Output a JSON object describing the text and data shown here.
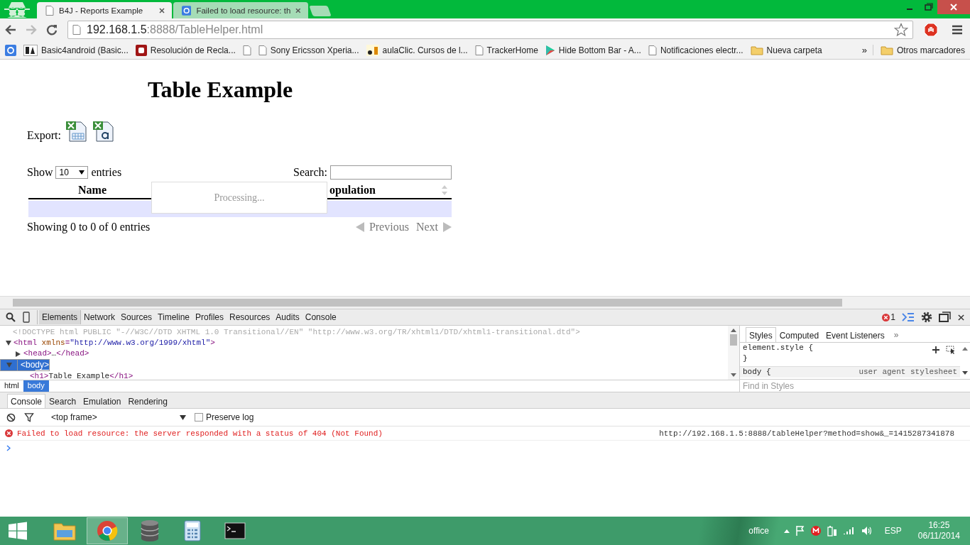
{
  "browser": {
    "tabs": [
      {
        "title": "B4J - Reports Example",
        "selected": true,
        "kind": "page"
      },
      {
        "title": "Failed to load resource: th",
        "selected": false,
        "kind": "g"
      }
    ],
    "address": {
      "host": "192.168.1.5",
      "rest": ":8888/TableHelper.html"
    },
    "bookmarks": [
      {
        "kind": "g"
      },
      {
        "kind": "b4a",
        "label": "Basic4android (Basic..."
      },
      {
        "kind": "e",
        "label": "Resolución de Recla..."
      },
      {
        "kind": "page"
      },
      {
        "kind": "page",
        "label": "Sony Ericsson Xperia..."
      },
      {
        "kind": "ac",
        "label": "aulaClic. Cursos de l..."
      },
      {
        "kind": "page",
        "label": "TrackerHome"
      },
      {
        "kind": "play",
        "label": "Hide Bottom Bar - A..."
      },
      {
        "kind": "page",
        "label": "Notificaciones electr..."
      },
      {
        "kind": "folder",
        "label": "Nueva carpeta"
      }
    ],
    "more": "»",
    "other": "Otros marcadores"
  },
  "page": {
    "heading": "Table Example",
    "export_label": "Export:",
    "exports": [
      {
        "kind": "sheet"
      },
      {
        "kind": "text"
      }
    ],
    "length": {
      "before": "Show",
      "value": "10",
      "after": "entries"
    },
    "search": {
      "label": "Search:"
    },
    "columns": [
      {
        "label": "Name"
      },
      {
        "label": "opulation"
      }
    ],
    "processing": "Processing...",
    "info": "Showing 0 to 0 of 0 entries",
    "pager": [
      {
        "kind": "previous",
        "label": "Previous",
        "disabled": true
      },
      {
        "kind": "next",
        "label": "Next",
        "disabled": true
      }
    ]
  },
  "devtools": {
    "panels": [
      {
        "label": "Elements",
        "selected": true
      },
      {
        "label": "Network",
        "selected": false
      },
      {
        "label": "Sources",
        "selected": false
      },
      {
        "label": "Timeline",
        "selected": false
      },
      {
        "label": "Profiles",
        "selected": false
      },
      {
        "label": "Resources",
        "selected": false
      },
      {
        "label": "Audits",
        "selected": false
      },
      {
        "label": "Console",
        "selected": false
      }
    ],
    "error_count": "1",
    "dom": [
      {
        "kind": "doctype",
        "selected": false,
        "parts": [
          {
            "kind": "doctype",
            "text": "<!DOCTYPE html PUBLIC \"-//W3C//DTD XHTML 1.0 Transitional//EN\" \"http://www.w3.org/TR/xhtml1/DTD/xhtml1-transitional.dtd\">"
          }
        ]
      },
      {
        "kind": "element",
        "expanded": true,
        "selected": false,
        "parts": [
          {
            "kind": "tag",
            "text": "<html"
          },
          {
            "kind": "attr",
            "text": " xmlns"
          },
          {
            "kind": "tag",
            "text": "="
          },
          {
            "kind": "value",
            "text": "\"http://www.w3.org/1999/xhtml\""
          },
          {
            "kind": "tag",
            "text": ">"
          }
        ]
      },
      {
        "kind": "element",
        "expanded": false,
        "selected": false,
        "parts": [
          {
            "kind": "tag",
            "text": "<head>"
          },
          {
            "kind": "text",
            "text": "…"
          },
          {
            "kind": "tag",
            "text": "</head>"
          }
        ]
      },
      {
        "kind": "element",
        "expanded": true,
        "selected": true,
        "parts": [
          {
            "kind": "tag",
            "text": "<body>"
          }
        ]
      },
      {
        "kind": "child",
        "selected": false,
        "parts": [
          {
            "kind": "tag",
            "text": "<h1>"
          },
          {
            "kind": "text",
            "text": "Table Example"
          },
          {
            "kind": "tag",
            "text": "</h1>"
          }
        ]
      }
    ],
    "breadcrumbs": [
      {
        "label": "html",
        "selected": false
      },
      {
        "label": "body",
        "selected": true
      }
    ],
    "styles_tabs": [
      {
        "label": "Styles",
        "selected": true
      },
      {
        "label": "Computed",
        "selected": false
      },
      {
        "label": "Event Listeners",
        "selected": false
      }
    ],
    "styles_more": "»",
    "style_lines": [
      {
        "text": "element.style {"
      },
      {
        "text": "}"
      },
      {
        "text": "body {",
        "origin": "user agent stylesheet"
      }
    ],
    "find_placeholder": "Find in Styles",
    "drawer_tabs": [
      {
        "label": "Console",
        "selected": true
      },
      {
        "label": "Search",
        "selected": false
      },
      {
        "label": "Emulation",
        "selected": false
      },
      {
        "label": "Rendering",
        "selected": false
      }
    ],
    "frame": "<top frame>",
    "preserve_log": {
      "label": "Preserve log",
      "checked": false
    },
    "messages": [
      {
        "kind": "error",
        "text": "Failed to load resource: the server responded with a status of 404 (Not Found)",
        "source": "http://192.168.1.5:8888/tableHelper?method=show&_=1415287341878"
      }
    ]
  },
  "taskbar": {
    "apps": [
      {
        "kind": "folder",
        "selected": false
      },
      {
        "kind": "browser",
        "selected": true
      },
      {
        "kind": "database",
        "selected": false
      },
      {
        "kind": "calculator",
        "selected": false
      },
      {
        "kind": "terminal",
        "selected": false
      }
    ],
    "tray": {
      "label": "office",
      "lang": "ESP",
      "time": "16:25",
      "date": "06/11/2014"
    }
  }
}
